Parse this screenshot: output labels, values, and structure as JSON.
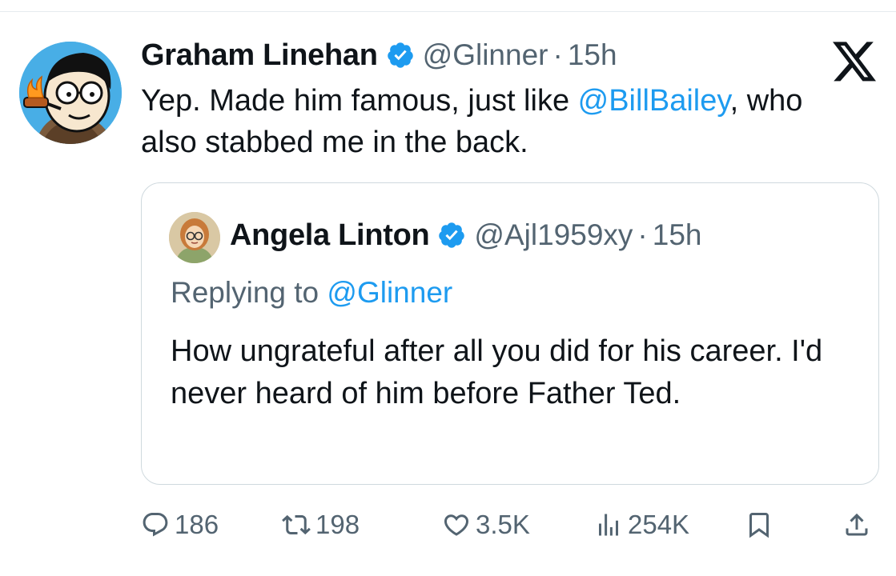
{
  "tweet": {
    "author_name": "Graham Linehan",
    "handle": "@Glinner",
    "separator": "·",
    "time": "15h",
    "text_part1": "Yep. Made him famous, just like ",
    "mention": "@BillBailey",
    "text_part2": ", who also stabbed me in the back."
  },
  "quote": {
    "author_name": "Angela Linton",
    "handle": "@Ajl1959xy",
    "separator": "·",
    "time": "15h",
    "replying_prefix": "Replying to ",
    "replying_handle": "@Glinner",
    "text": "How ungrateful after all you did for his career. I'd never heard of him before Father Ted."
  },
  "actions": {
    "replies": "186",
    "retweets": "198",
    "likes": "3.5K",
    "views": "254K"
  },
  "icons": {
    "verified": "verified-badge-icon",
    "brand": "x-logo-icon",
    "reply": "reply-icon",
    "retweet": "retweet-icon",
    "like": "heart-icon",
    "views": "views-icon",
    "bookmark": "bookmark-icon",
    "share": "share-icon"
  },
  "colors": {
    "accent": "#1d9bf0",
    "text": "#0f1419",
    "muted": "#536471",
    "border": "#cfd9de"
  }
}
